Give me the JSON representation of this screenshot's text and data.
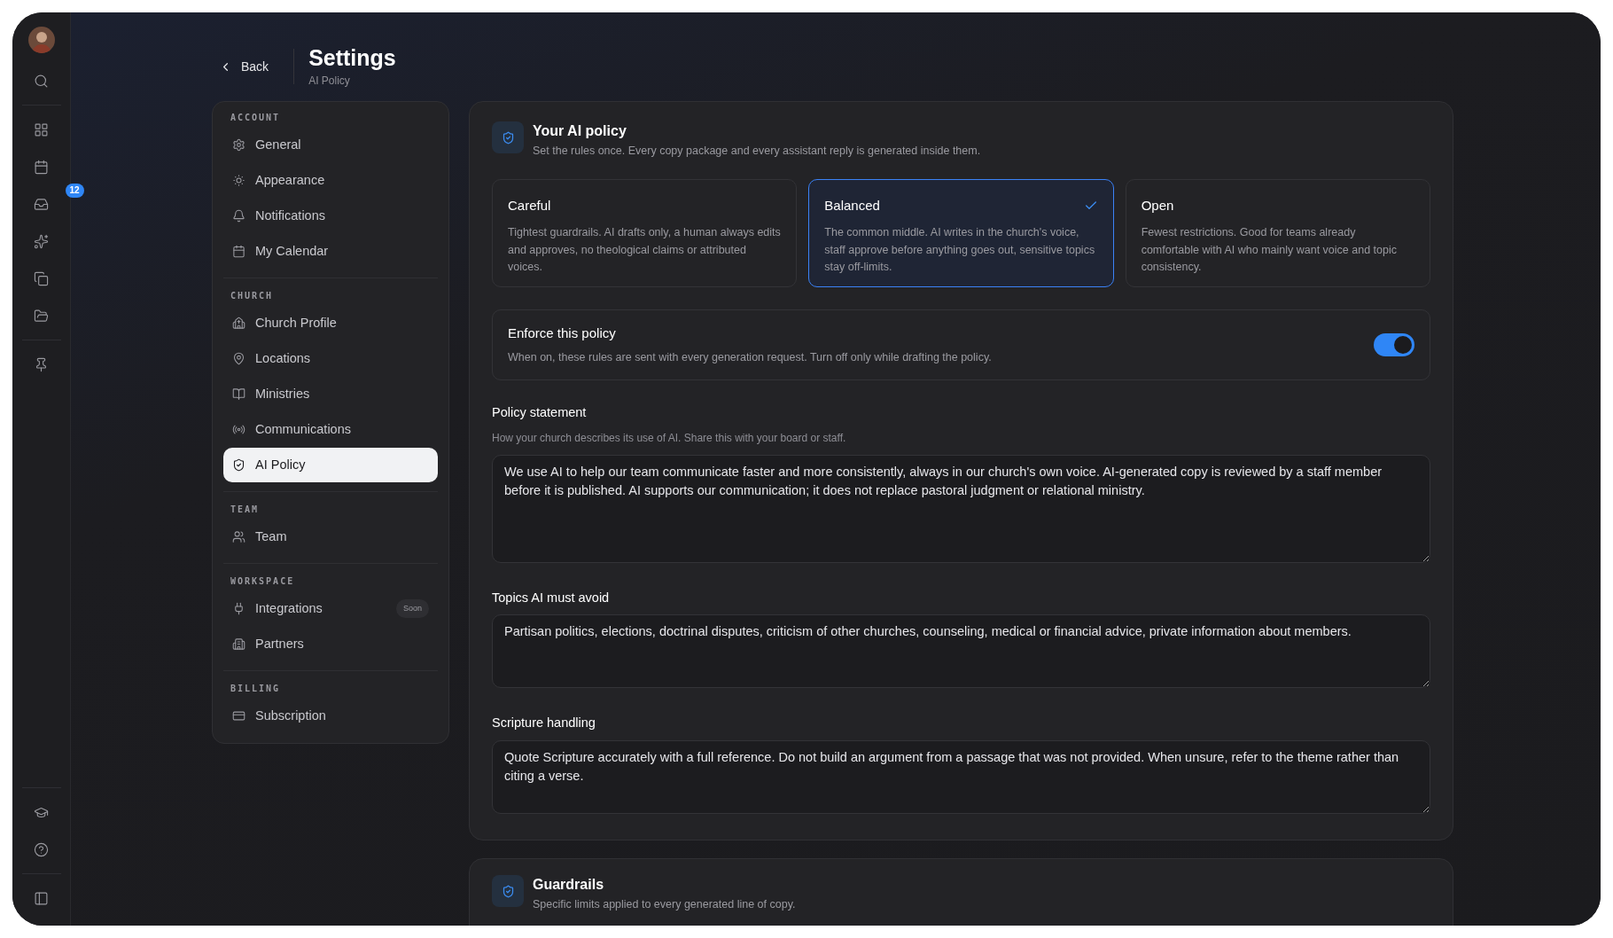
{
  "rail": {
    "inbox_badge": "12"
  },
  "header": {
    "back": "Back",
    "title": "Settings",
    "subtitle": "AI Policy"
  },
  "sidebar": {
    "sections": [
      {
        "title": "ACCOUNT",
        "items": [
          {
            "label": "General",
            "selected": false
          },
          {
            "label": "Appearance",
            "selected": false
          },
          {
            "label": "Notifications",
            "selected": false
          },
          {
            "label": "My Calendar",
            "selected": false
          }
        ]
      },
      {
        "title": "CHURCH",
        "items": [
          {
            "label": "Church Profile",
            "selected": false
          },
          {
            "label": "Locations",
            "selected": false
          },
          {
            "label": "Ministries",
            "selected": false
          },
          {
            "label": "Communications",
            "selected": false
          },
          {
            "label": "AI Policy",
            "selected": true
          }
        ]
      },
      {
        "title": "TEAM",
        "items": [
          {
            "label": "Team",
            "selected": false
          }
        ]
      },
      {
        "title": "WORKSPACE",
        "items": [
          {
            "label": "Integrations",
            "selected": false,
            "badge": "Soon"
          },
          {
            "label": "Partners",
            "selected": false
          }
        ]
      },
      {
        "title": "BILLING",
        "items": [
          {
            "label": "Subscription",
            "selected": false
          }
        ]
      }
    ]
  },
  "policy": {
    "title": "Your AI policy",
    "description": "Set the rules once. Every copy package and every assistant reply is generated inside them.",
    "options": [
      {
        "title": "Careful",
        "description": "Tightest guardrails. AI drafts only, a human always edits and approves, no theological claims or attributed voices.",
        "selected": false
      },
      {
        "title": "Balanced",
        "description": "The common middle. AI writes in the church's voice, staff approve before anything goes out, sensitive topics stay off-limits.",
        "selected": true
      },
      {
        "title": "Open",
        "description": "Fewest restrictions. Good for teams already comfortable with AI who mainly want voice and topic consistency.",
        "selected": false
      }
    ],
    "enforce": {
      "title": "Enforce this policy",
      "description": "When on, these rules are sent with every generation request. Turn off only while drafting the policy.",
      "on": true
    },
    "fields": [
      {
        "label": "Policy statement",
        "hint": "How your church describes its use of AI. Share this with your board or staff.",
        "value": "We use AI to help our team communicate faster and more consistently, always in our church's own voice. AI-generated copy is reviewed by a staff member before it is published. AI supports our communication; it does not replace pastoral judgment or relational ministry."
      },
      {
        "label": "Topics AI must avoid",
        "value": "Partisan politics, elections, doctrinal disputes, criticism of other churches, counseling, medical or financial advice, private information about members."
      },
      {
        "label": "Scripture handling",
        "value": "Quote Scripture accurately with a full reference. Do not build an argument from a passage that was not provided. When unsure, refer to the theme rather than citing a verse."
      }
    ]
  },
  "guardrails": {
    "title": "Guardrails",
    "description": "Specific limits applied to every generated line of copy."
  }
}
